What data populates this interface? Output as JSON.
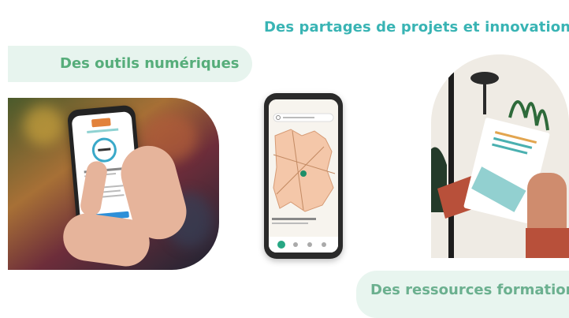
{
  "labels": {
    "projects": "Des partages de projets et innovations",
    "tools": "Des outils numériques",
    "resources": "Des ressources formation"
  },
  "colors": {
    "teal": "#39b4b4",
    "green": "#56ad7a",
    "pill_bg": "#e7f4ee"
  }
}
